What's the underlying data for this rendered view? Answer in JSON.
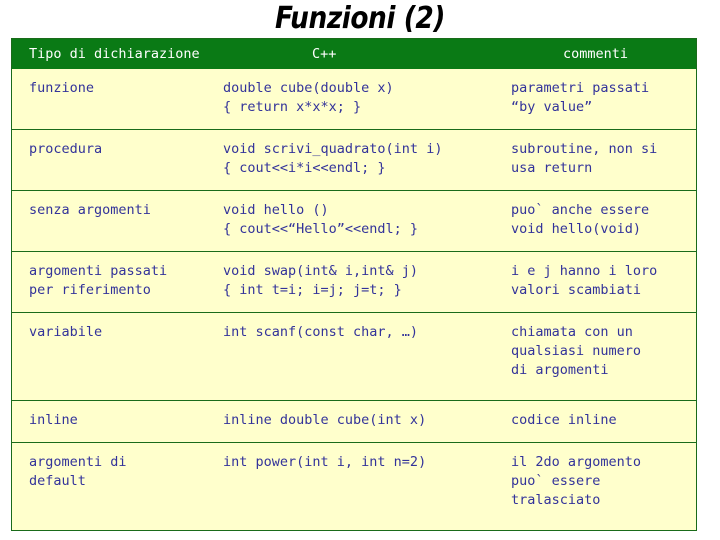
{
  "slide": {
    "title": "Funzioni (2)",
    "colors": {
      "header_bg": "#0a7a15",
      "header_text": "#ffffff",
      "row_bg": "#ffffcc",
      "body_text": "#33339a",
      "border": "#1a6b1a",
      "title_text": "#000000"
    }
  },
  "table": {
    "headers": [
      "Tipo di dichiarazione",
      "C++",
      "commenti"
    ],
    "rows": [
      {
        "tipo": "funzione",
        "cpp": "double cube(double x)\n{   return x*x*x; }",
        "commento": "parametri passati\n“by value”"
      },
      {
        "tipo": "procedura",
        "cpp": "void scrivi_quadrato(int i)\n{   cout<<i*i<<endl; }",
        "commento": "subroutine, non si\nusa return"
      },
      {
        "tipo": "senza argomenti",
        "cpp": "void hello ()\n{ cout<<“Hello”<<endl; }",
        "commento": "puo` anche essere\nvoid hello(void)"
      },
      {
        "tipo": "argomenti passati\nper riferimento",
        "cpp": "void swap(int& i,int& j)\n{ int t=i; i=j; j=t; }",
        "commento": "i e j hanno i loro\nvalori scambiati"
      },
      {
        "tipo": "variabile",
        "cpp": "int scanf(const char, …)",
        "commento": "chiamata con un\nqualsiasi numero\ndi argomenti"
      },
      {
        "tipo": "inline",
        "cpp": "inline double cube(int x)",
        "commento": "codice inline"
      },
      {
        "tipo": "argomenti di\ndefault",
        "cpp": "int power(int i, int n=2)",
        "commento": "il 2do argomento\npuo` essere\ntralasciato"
      }
    ]
  }
}
